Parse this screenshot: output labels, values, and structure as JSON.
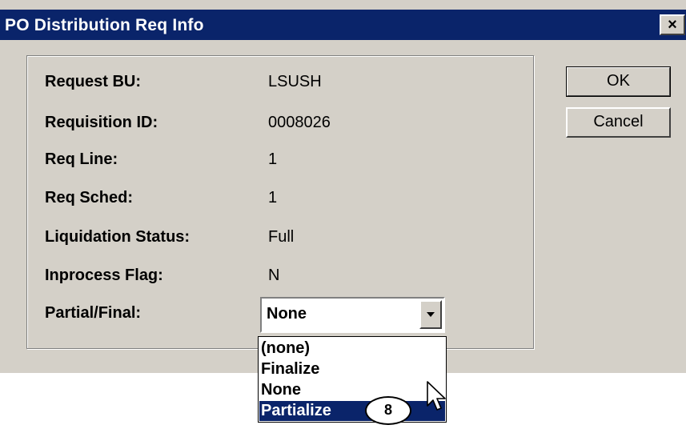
{
  "window": {
    "title": "PO Distribution Req Info",
    "close_label": "×"
  },
  "buttons": {
    "ok": "OK",
    "cancel": "Cancel"
  },
  "fields": [
    {
      "label": "Request BU:",
      "value": "LSUSH"
    },
    {
      "label": "Requisition ID:",
      "value": "0008026"
    },
    {
      "label": "Req Line:",
      "value": "1"
    },
    {
      "label": "Req Sched:",
      "value": "1"
    },
    {
      "label": "Liquidation Status:",
      "value": "Full"
    },
    {
      "label": "Inprocess Flag:",
      "value": "N"
    }
  ],
  "partial_final": {
    "label": "Partial/Final:",
    "selected": "None",
    "options": [
      "(none)",
      "Finalize",
      "None",
      "Partialize"
    ],
    "highlighted": "Partialize"
  },
  "callout": {
    "step": "8"
  }
}
